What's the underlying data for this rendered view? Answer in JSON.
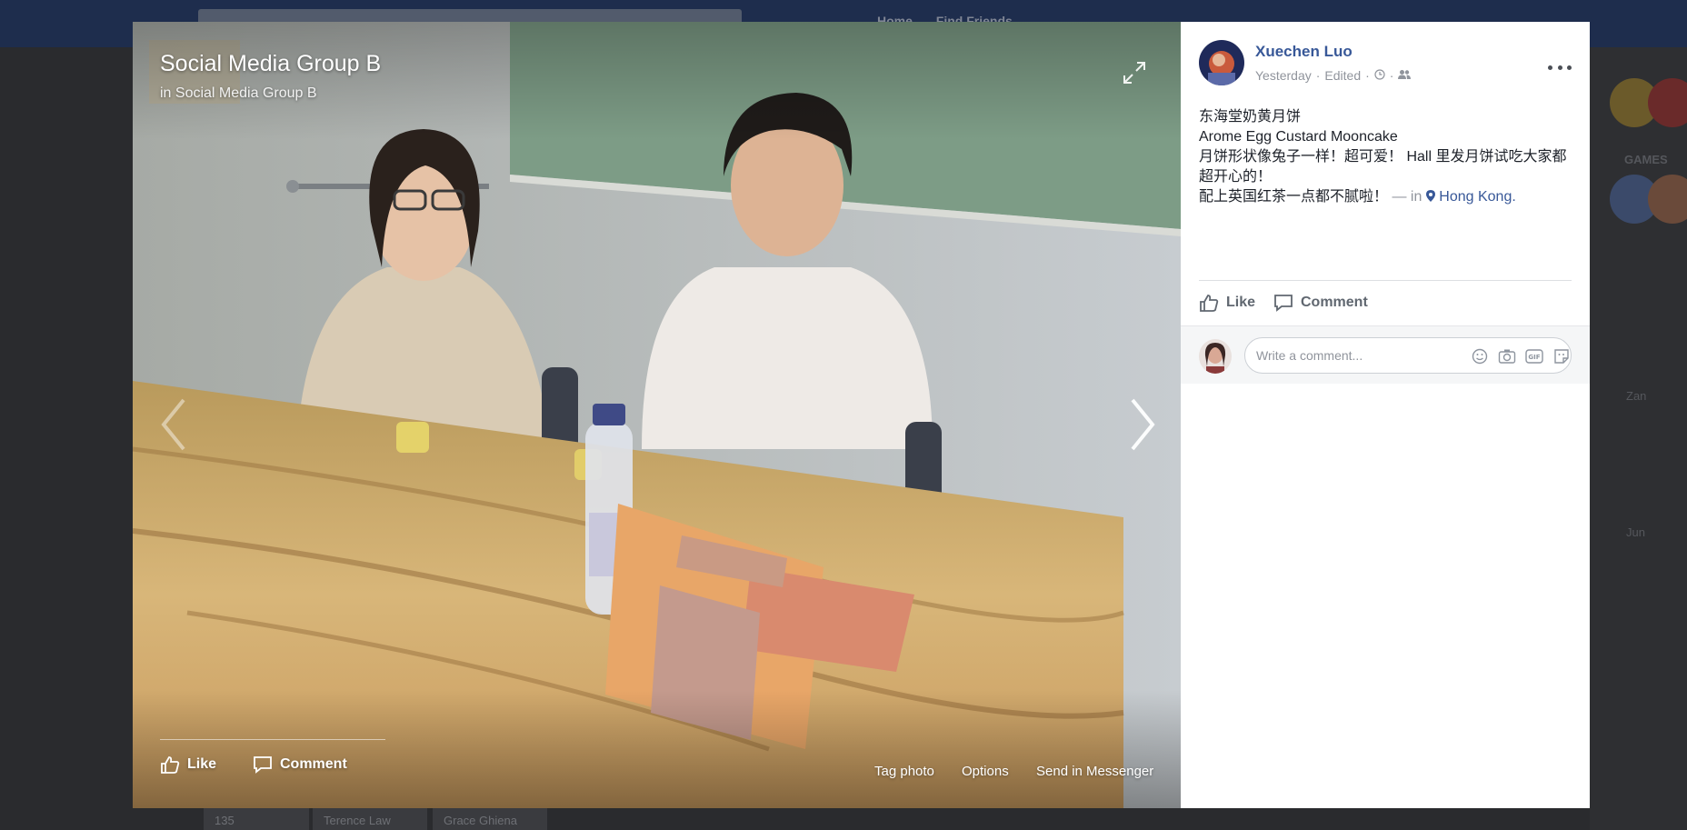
{
  "background": {
    "nav_items": [
      "Home",
      "Find Friends"
    ],
    "right_rail_text": [
      "GAMES",
      "Zan",
      "Jun"
    ],
    "bottom_items": [
      "135",
      "Terence Law",
      "Grace Ghiena"
    ]
  },
  "viewer": {
    "group_title": "Social Media Group B",
    "group_subtitle": "in Social Media Group B",
    "actions": {
      "like": "Like",
      "comment": "Comment"
    },
    "links": {
      "tag_photo": "Tag photo",
      "options": "Options",
      "send_messenger": "Send in Messenger"
    }
  },
  "post": {
    "author": "Xuechen Luo",
    "time": "Yesterday",
    "edited": "Edited",
    "lines": [
      "东海堂奶黄月饼",
      "Arome Egg Custard Mooncake",
      "月饼形状像兔子一样！超可爱！ Hall 里发月饼试吃大家都超开心的！",
      "配上英国红茶一点都不腻啦！"
    ],
    "location_prefix": "— in",
    "location": "Hong Kong.",
    "actions": {
      "like": "Like",
      "comment": "Comment"
    }
  },
  "comment_box": {
    "placeholder": "Write a comment..."
  },
  "colors": {
    "link": "#385898",
    "muted": "#90949c",
    "text": "#1d2129"
  },
  "icons": [
    "expand-icon",
    "chevron-left-icon",
    "chevron-right-icon",
    "like-icon",
    "comment-icon",
    "clock-icon",
    "friends-icon",
    "more-icon",
    "emoji-icon",
    "camera-icon",
    "gif-icon",
    "sticker-icon",
    "location-pin-icon"
  ]
}
